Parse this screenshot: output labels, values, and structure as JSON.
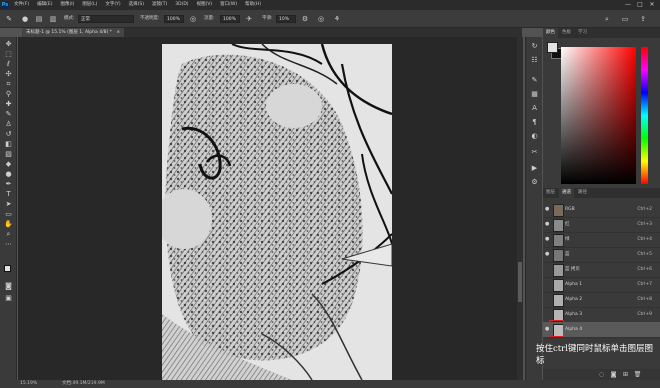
{
  "menubar": {
    "logo": "Ps",
    "items": [
      "文件(F)",
      "编辑(E)",
      "图像(I)",
      "图层(L)",
      "文字(Y)",
      "选择(S)",
      "滤镜(T)",
      "3D(D)",
      "视图(V)",
      "窗口(W)",
      "帮助(H)"
    ],
    "window_controls": [
      "—",
      "□",
      "✕"
    ]
  },
  "options": {
    "mode_label": "模式:",
    "mode_value": "正常",
    "opacity_label": "不透明度:",
    "opacity_value": "100%",
    "flow_label": "流量:",
    "flow_value": "100%",
    "smoothing_label": "平滑:",
    "smoothing_value": "10%"
  },
  "document": {
    "tab_title": "未标题-1 @ 15.1% (图层 1, Alpha 4/8) *",
    "close": "×"
  },
  "status": {
    "zoom": "15.19%",
    "doc_info": "文档:49.1M/219.9M"
  },
  "color_panel": {
    "tabs": [
      "颜色",
      "色板",
      "学习"
    ],
    "fg_color": "#e3e3e3",
    "bg_color": "#111111"
  },
  "channels_panel": {
    "tabs": [
      "图层",
      "通道",
      "路径"
    ],
    "rows": [
      {
        "name": "RGB",
        "key": "Ctrl+2"
      },
      {
        "name": "红",
        "key": "Ctrl+3"
      },
      {
        "name": "绿",
        "key": "Ctrl+4"
      },
      {
        "name": "蓝",
        "key": "Ctrl+5"
      },
      {
        "name": "蓝 拷贝",
        "key": "Ctrl+6"
      },
      {
        "name": "Alpha 1",
        "key": "Ctrl+7"
      },
      {
        "name": "Alpha 2",
        "key": "Ctrl+8"
      },
      {
        "name": "Alpha 3",
        "key": "Ctrl+9"
      },
      {
        "name": "Alpha 4",
        "key": ""
      }
    ]
  },
  "annotation": {
    "text": "按住ctrl键同时鼠标单击图层图标"
  }
}
